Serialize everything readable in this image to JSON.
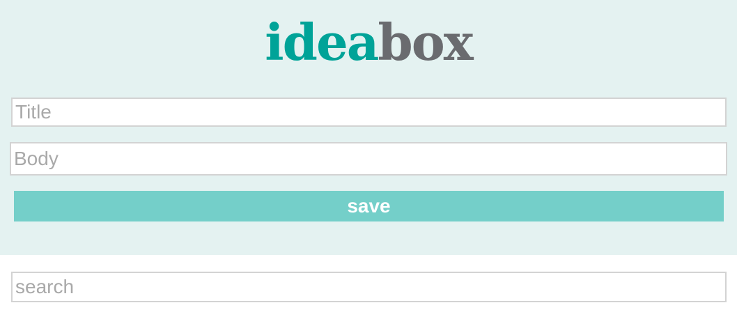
{
  "header": {
    "logo": {
      "part1": "idea",
      "part2": "box",
      "part1_color": "#00a398",
      "part2_color": "#6a6b6f"
    },
    "background_color": "#e4f2f1"
  },
  "form": {
    "title_placeholder": "Title",
    "title_value": "",
    "body_placeholder": "Body",
    "body_value": "",
    "save_label": "save",
    "save_color": "#74cfc9"
  },
  "search": {
    "placeholder": "search",
    "value": ""
  }
}
